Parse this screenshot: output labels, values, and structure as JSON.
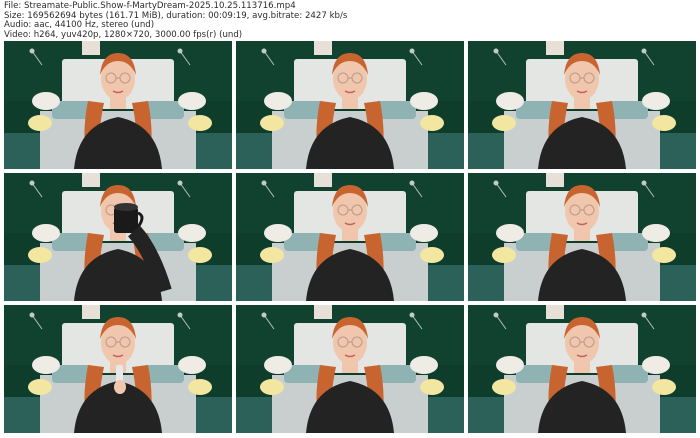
{
  "header": {
    "file": "File: Streamate-Public.Show-f-MartyDream-2025.10.25.113716.mp4",
    "size": "Size: 169562694 bytes (161.71 MiB), duration: 00:09:19, avg.bitrate: 2427 kb/s",
    "audio": "Audio: aac, 44100 Hz, stereo (und)",
    "video": "Video: h264, yuv420p, 1280×720, 3000.00 fps(r) (und)"
  },
  "thumbnails": [
    {
      "pose": "neutral"
    },
    {
      "pose": "neutral"
    },
    {
      "pose": "neutral"
    },
    {
      "pose": "drinking-mug"
    },
    {
      "pose": "neutral"
    },
    {
      "pose": "neutral"
    },
    {
      "pose": "holding-item"
    },
    {
      "pose": "neutral"
    },
    {
      "pose": "neutral"
    }
  ],
  "colors": {
    "wall": "#0f3d2c",
    "hair": "#c8642f",
    "skin": "#f0c7ad",
    "sweater": "#232323",
    "bed": "#c9cfcf",
    "pillow": "#8fb3b2",
    "lamp": "#f3e6a0"
  }
}
